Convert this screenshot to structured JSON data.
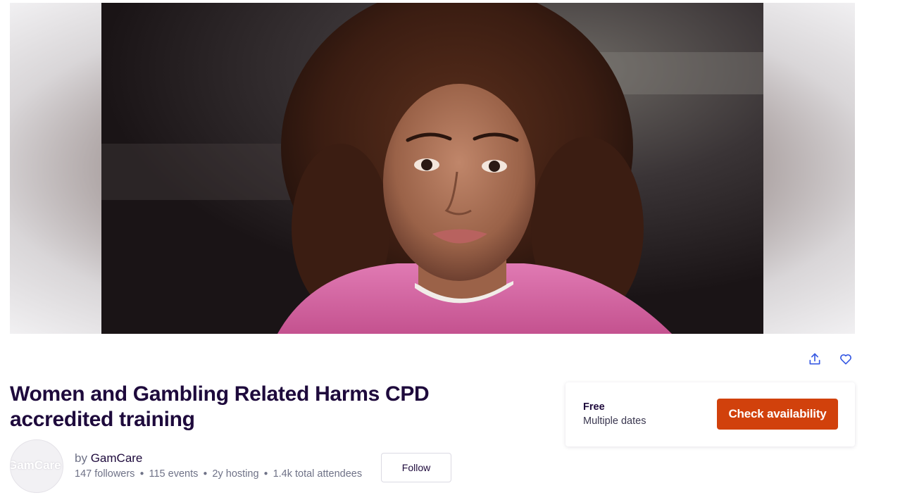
{
  "hero": {
    "alt": "Event banner photo"
  },
  "actions": {
    "share_icon": "share-icon",
    "like_icon": "heart-icon"
  },
  "event": {
    "title": "Women and Gambling Related Harms CPD accredited training"
  },
  "organizer": {
    "by_label": "by",
    "name": "GamCare",
    "avatar_text": "GamCare",
    "stats": {
      "followers": "147 followers",
      "events": "115 events",
      "hosting": "2y hosting",
      "attendees": "1.4k total attendees"
    },
    "follow_label": "Follow"
  },
  "ticket": {
    "price": "Free",
    "dates": "Multiple dates",
    "cta_label": "Check availability"
  },
  "colors": {
    "accent": "#d1410c",
    "title": "#1e0a3c",
    "icon": "#3659e3"
  }
}
